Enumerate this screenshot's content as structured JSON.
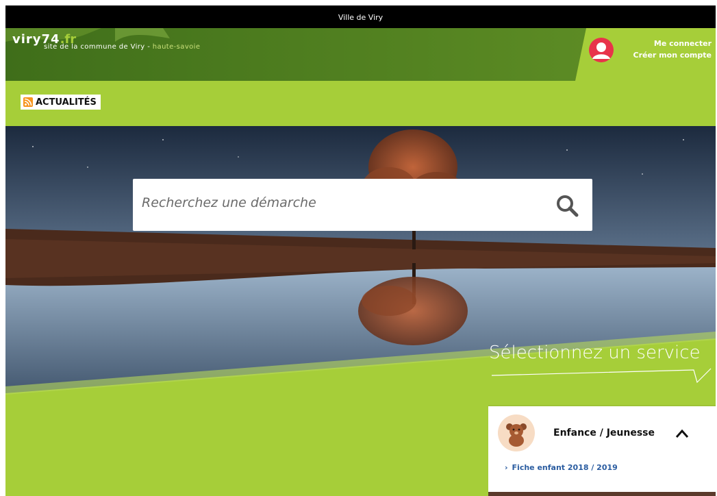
{
  "topbar": {
    "title": "Ville de Viry"
  },
  "header": {
    "brand_name": "viry74",
    "brand_tld": ".fr",
    "brand_sub_main": "site de la commune de Viry - ",
    "brand_sub_region": "haute-savoie",
    "login_label": "Me connecter",
    "register_label": "Créer mon compte"
  },
  "news": {
    "label": "ACTUALITÉS"
  },
  "search": {
    "placeholder": "Recherchez une démarche"
  },
  "services": {
    "title": "Sélectionnez un service",
    "card": {
      "title": "Enfance / Jeunesse",
      "link": "Fiche enfant 2018 / 2019"
    }
  },
  "colors": {
    "brand_green": "#a6ce39",
    "header_dark_green": "#4e7d1f",
    "avatar_red": "#e8334a",
    "rss_orange": "#f7941d",
    "link_blue": "#2a5ca0"
  },
  "icons": [
    "user-avatar-icon",
    "rss-icon",
    "search-icon",
    "teddy-bear-icon",
    "chevron-up-icon",
    "chevron-right-icon"
  ]
}
